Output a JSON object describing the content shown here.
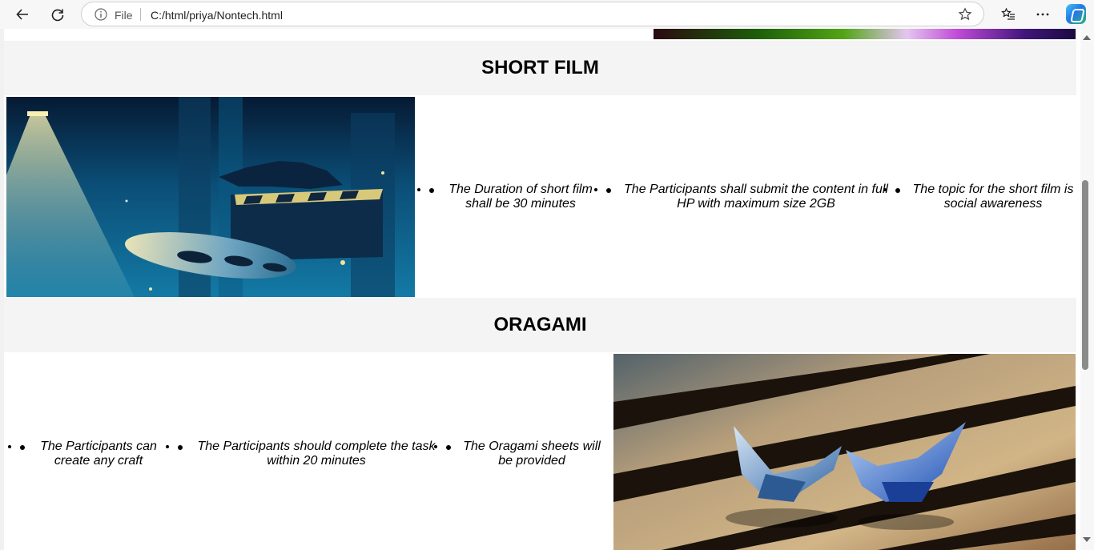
{
  "browser": {
    "address_label": "File",
    "url": "C:/html/priya/Nontech.html",
    "icons": [
      "back-arrow-icon",
      "refresh-icon",
      "info-icon",
      "favorite-star-icon",
      "favorites-icon",
      "more-icon",
      "copilot-icon"
    ]
  },
  "sections": [
    {
      "title": "SHORT FILM",
      "bullets": [
        "The Duration of short film shall be 30 minutes",
        "The Participants shall submit the content in full HP with maximum size 2GB",
        "The topic for the short film is social awareness"
      ]
    },
    {
      "title": "ORAGAMI",
      "bullets": [
        "The Participants can create any craft",
        "The Participants should complete the task within 20 minutes",
        "The Oragami sheets will be provided"
      ]
    }
  ],
  "colors": {
    "section_header_bg": "#f4f4f4",
    "film_blue": "#0e5d87",
    "page_bg": "#ffffff"
  }
}
